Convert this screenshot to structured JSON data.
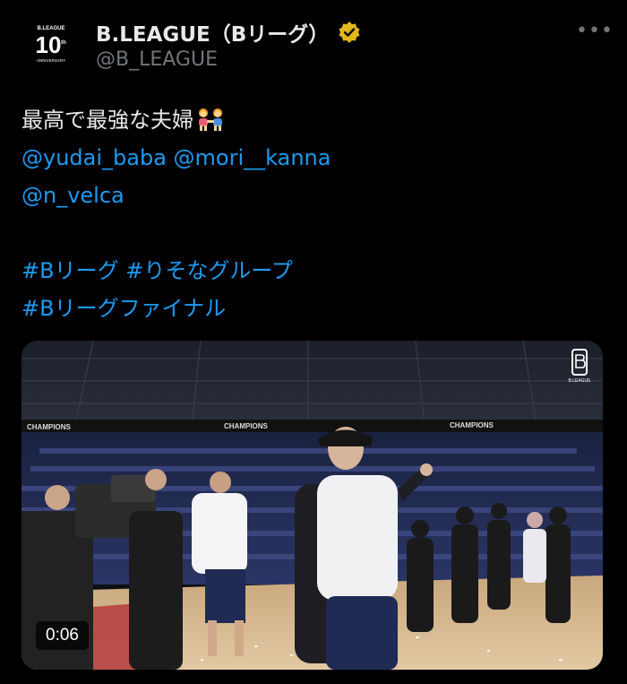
{
  "author": {
    "display_name": "B.LEAGUE（Bリーグ）",
    "handle": "@B_LEAGUE",
    "avatar_text": "B.LEAGUE",
    "avatar_number": "10",
    "avatar_sup": "th",
    "avatar_sub": "ANNIVERSARY",
    "verified": true
  },
  "more_label": "•••",
  "tweet": {
    "line1": "最高で最強な夫婦",
    "mention1": "@yudai_baba",
    "mention2": "@mori__kanna",
    "mention3": "@n_velca",
    "hashtag1": "#Bリーグ",
    "hashtag2": "#りそなグループ",
    "hashtag3": "#Bリーグファイナル"
  },
  "media": {
    "type": "video",
    "duration": "0:06",
    "banner_text": "CHAMPIONS",
    "watermark_text": "B.LEAGUE"
  },
  "colors": {
    "background": "#000000",
    "text": "#e7e9ea",
    "secondary": "#71767b",
    "link": "#1d9bf0",
    "verified": "#e2b719"
  }
}
